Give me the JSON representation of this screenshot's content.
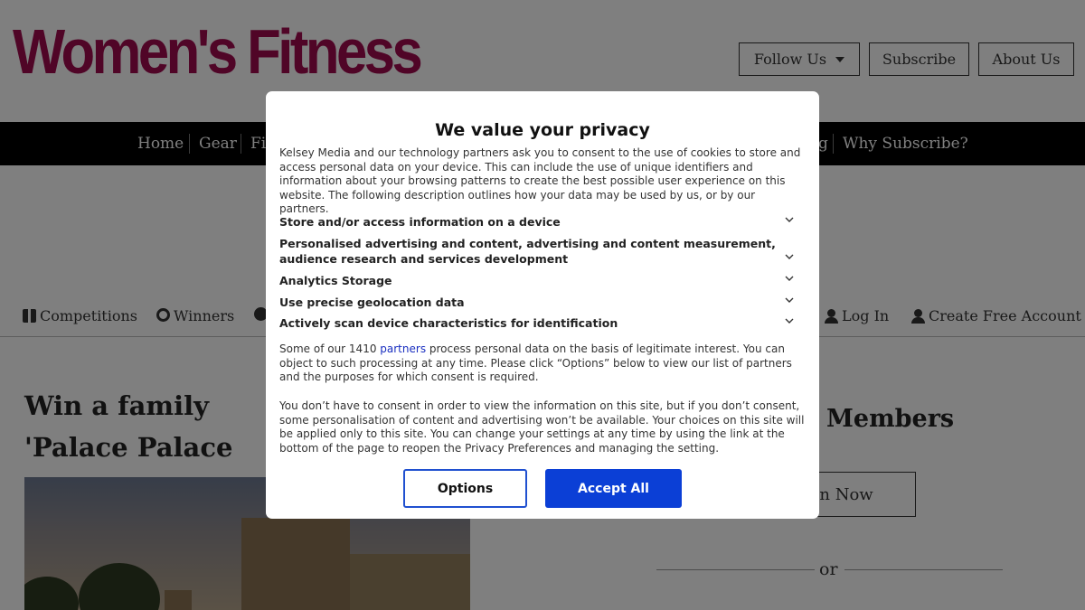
{
  "site": {
    "logo_text": "Women's Fitness",
    "brand_color": "#a10a4e"
  },
  "header": {
    "follow_label": "Follow Us",
    "subscribe_label": "Subscribe",
    "about_label": "About Us"
  },
  "nav": {
    "items": [
      "Home",
      "Gear",
      "Fi",
      "g",
      "Why Subscribe?"
    ]
  },
  "subnav": {
    "competitions": "Competitions",
    "winners": "Winners",
    "login": "Log In",
    "create_account": "Create Free Account"
  },
  "article": {
    "title": "Win a family 'Palace Palace"
  },
  "sidebar": {
    "members_heading": "Members",
    "login_button": "In Now",
    "or_text": "or"
  },
  "consent": {
    "title": "We value your privacy",
    "intro": "Kelsey Media and our technology partners ask you to consent to the use of cookies to store and access personal data on your device. This can include the use of unique identifiers and information about your browsing patterns to create the best possible user experience on this website. The following description outlines how your data may be used by us, or by our partners.",
    "purposes": [
      "Store and/or access information on a device",
      "Personalised advertising and content, advertising and content measurement, audience research and services development",
      "Analytics Storage",
      "Use precise geolocation data",
      "Actively scan device characteristics for identification"
    ],
    "legit_before": "Some of our 1410 ",
    "legit_link": "partners",
    "legit_after": " process personal data on the basis of legitimate interest. You can object to such processing at any time. Please click “Options” below to view our list of partners and the purposes for which consent is required.",
    "no_consent": "You don’t have to consent in order to view the information on this site, but if you don’t consent, some personalisation of content and advertising won’t be available. Your choices on this site will be applied only to this site. You can change your settings at any time by using the link at the bottom of the page to reopen the Privacy Preferences and managing the setting.",
    "options_label": "Options",
    "accept_label": "Accept All",
    "accent_color": "#0b3fd6"
  }
}
